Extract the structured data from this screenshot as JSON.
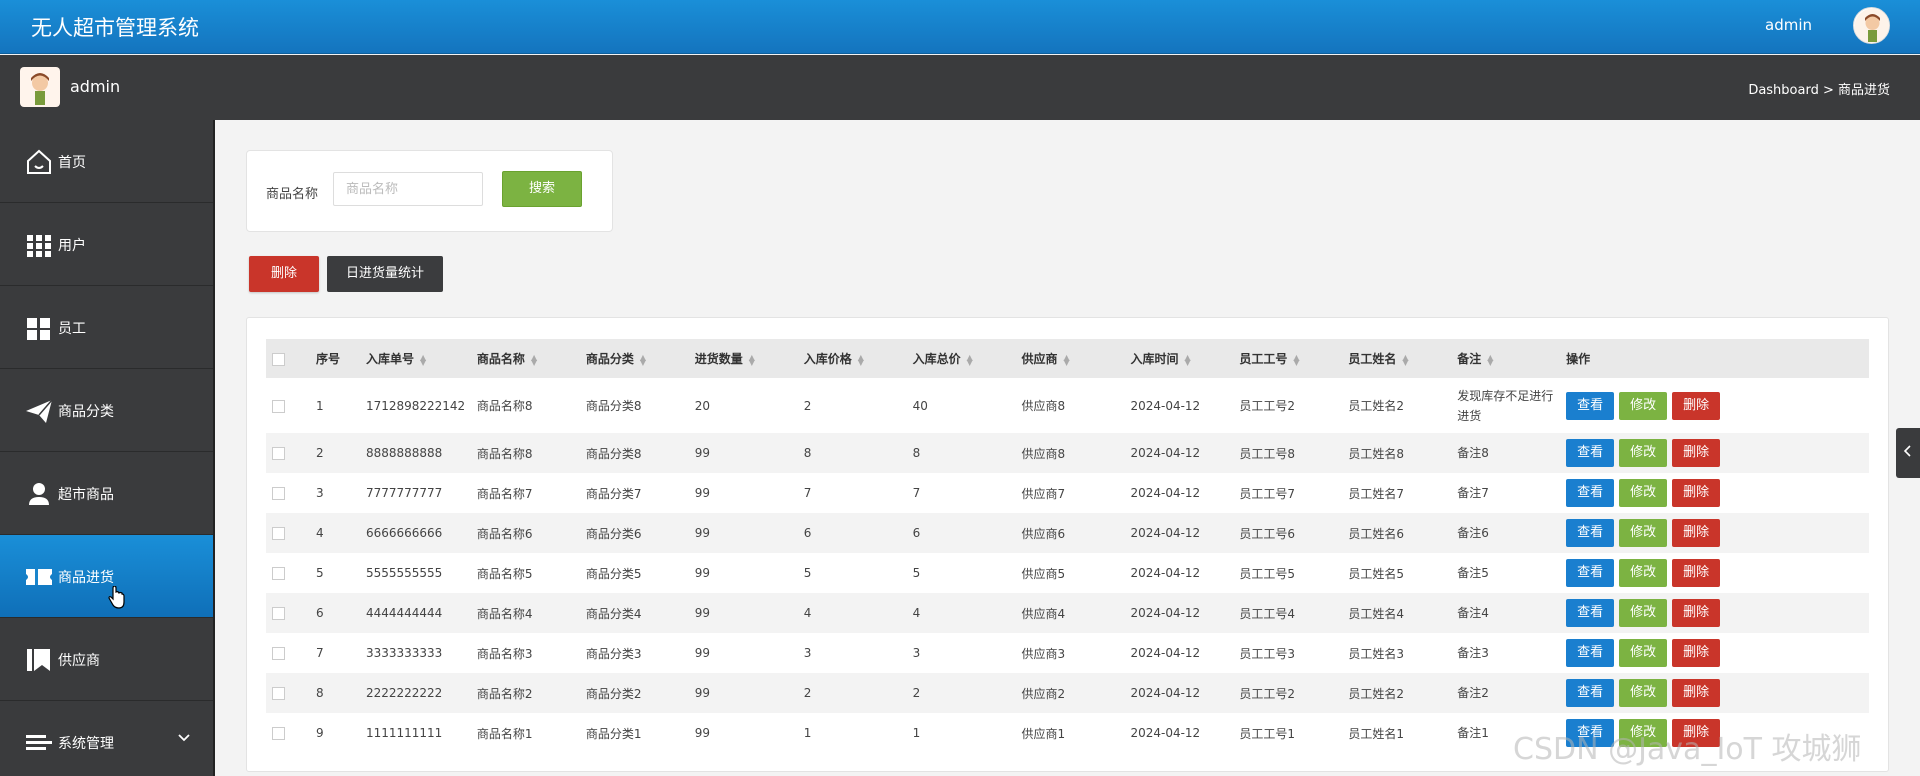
{
  "app": {
    "title": "无人超市管理系统",
    "user": "admin"
  },
  "subbar": {
    "username": "admin",
    "breadcrumb": "Dashboard > 商品进货"
  },
  "sidebar": {
    "items": [
      {
        "label": "首页",
        "icon": "home-icon"
      },
      {
        "label": "用户",
        "icon": "grid-icon"
      },
      {
        "label": "员工",
        "icon": "tiles-icon"
      },
      {
        "label": "商品分类",
        "icon": "paper-plane-icon"
      },
      {
        "label": "超市商品",
        "icon": "person-icon"
      },
      {
        "label": "商品进货",
        "icon": "ticket-icon",
        "active": true
      },
      {
        "label": "供应商",
        "icon": "book-icon"
      },
      {
        "label": "系统管理",
        "icon": "menu-icon"
      }
    ]
  },
  "search": {
    "label": "商品名称",
    "placeholder": "商品名称",
    "value": "",
    "button": "搜索"
  },
  "toolbar": {
    "delete": "删除",
    "stats": "日进货量统计"
  },
  "table": {
    "headers": [
      "序号",
      "入库单号",
      "商品名称",
      "商品分类",
      "进货数量",
      "入库价格",
      "入库总价",
      "供应商",
      "入库时间",
      "员工工号",
      "员工姓名",
      "备注",
      "操作"
    ],
    "actions": {
      "view": "查看",
      "edit": "修改",
      "delete": "删除"
    },
    "rows": [
      [
        "1",
        "1712898222142",
        "商品名称8",
        "商品分类8",
        "20",
        "2",
        "40",
        "供应商8",
        "2024-04-12",
        "员工工号2",
        "员工姓名2",
        "发现库存不足进行进货"
      ],
      [
        "2",
        "8888888888",
        "商品名称8",
        "商品分类8",
        "99",
        "8",
        "8",
        "供应商8",
        "2024-04-12",
        "员工工号8",
        "员工姓名8",
        "备注8"
      ],
      [
        "3",
        "7777777777",
        "商品名称7",
        "商品分类7",
        "99",
        "7",
        "7",
        "供应商7",
        "2024-04-12",
        "员工工号7",
        "员工姓名7",
        "备注7"
      ],
      [
        "4",
        "6666666666",
        "商品名称6",
        "商品分类6",
        "99",
        "6",
        "6",
        "供应商6",
        "2024-04-12",
        "员工工号6",
        "员工姓名6",
        "备注6"
      ],
      [
        "5",
        "5555555555",
        "商品名称5",
        "商品分类5",
        "99",
        "5",
        "5",
        "供应商5",
        "2024-04-12",
        "员工工号5",
        "员工姓名5",
        "备注5"
      ],
      [
        "6",
        "4444444444",
        "商品名称4",
        "商品分类4",
        "99",
        "4",
        "4",
        "供应商4",
        "2024-04-12",
        "员工工号4",
        "员工姓名4",
        "备注4"
      ],
      [
        "7",
        "3333333333",
        "商品名称3",
        "商品分类3",
        "99",
        "3",
        "3",
        "供应商3",
        "2024-04-12",
        "员工工号3",
        "员工姓名3",
        "备注3"
      ],
      [
        "8",
        "2222222222",
        "商品名称2",
        "商品分类2",
        "99",
        "2",
        "2",
        "供应商2",
        "2024-04-12",
        "员工工号2",
        "员工姓名2",
        "备注2"
      ],
      [
        "9",
        "1111111111",
        "商品名称1",
        "商品分类1",
        "99",
        "1",
        "1",
        "供应商1",
        "2024-04-12",
        "员工工号1",
        "员工姓名1",
        "备注1"
      ]
    ]
  },
  "watermark": "CSDN @Java_IoT 攻城狮",
  "colors": {
    "primary": "#1a8fd8",
    "success": "#7cb342",
    "danger": "#c9352a",
    "dark": "#3a3b3d"
  }
}
